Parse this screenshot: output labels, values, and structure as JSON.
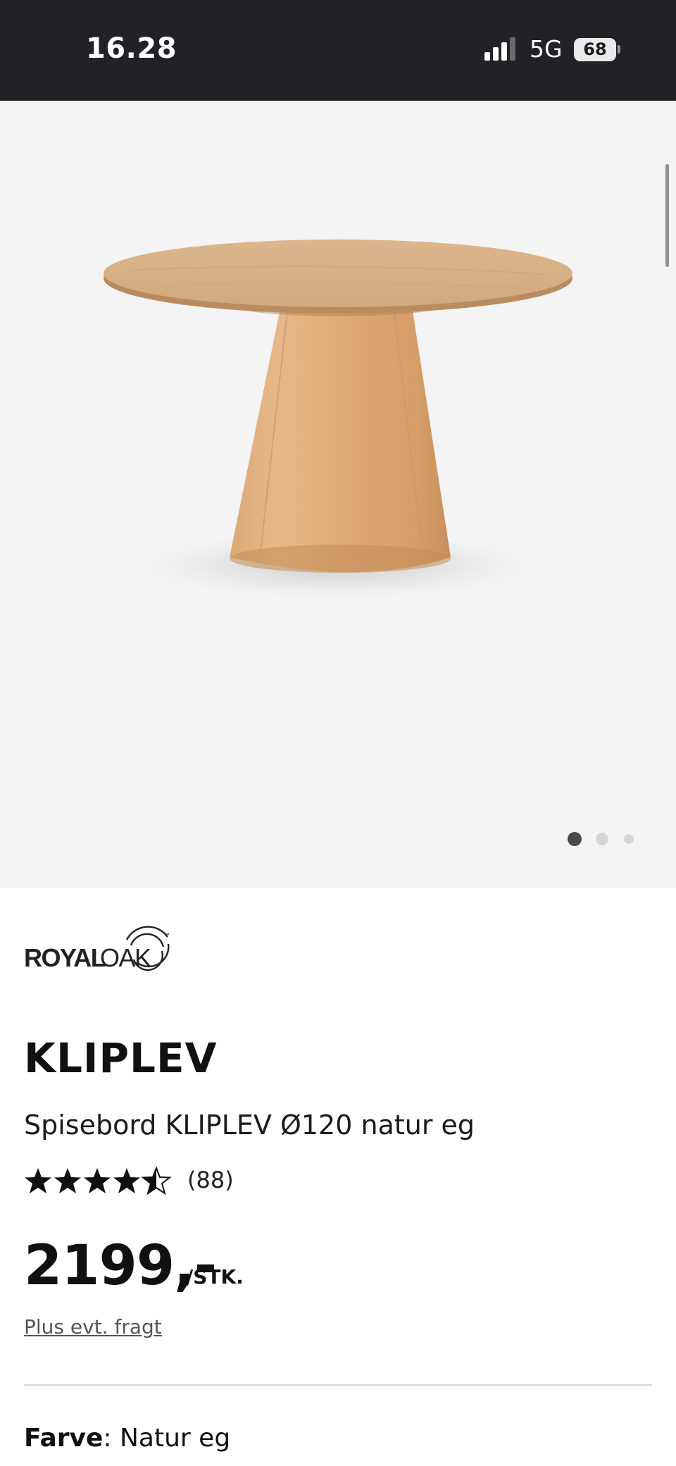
{
  "status_bar": {
    "time": "16.28",
    "network": "5G",
    "battery": "68"
  },
  "gallery": {
    "page_count": 3,
    "active_page": 1
  },
  "brand": {
    "logo_text_bold": "ROYAL",
    "logo_text_light": "OAK",
    "trademark": "™"
  },
  "product": {
    "name": "KLIPLEV",
    "description": "Spisebord KLIPLEV Ø120 natur eg",
    "rating_value": 4.5,
    "rating_max": 5,
    "rating_count": "(88)",
    "price": "2199,-",
    "unit": "/STK.",
    "shipping_note": "Plus evt. fragt",
    "color_label": "Farve",
    "color_separator": ": ",
    "color_value": "Natur eg"
  }
}
